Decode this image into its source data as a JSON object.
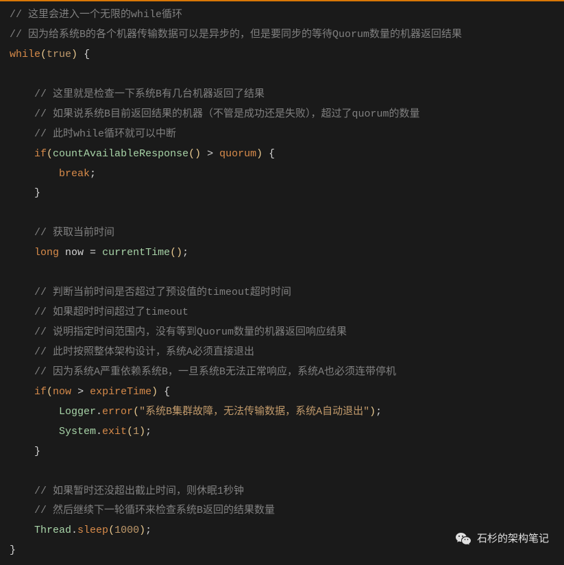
{
  "code": {
    "c1": "// 这里会进入一个无限的while循环",
    "c2": "// 因为给系统B的各个机器传输数据可以是异步的，但是要同步的等待Quorum数量的机器返回结果",
    "kw_while": "while",
    "lp1": "(",
    "true": "true",
    "rp1": ")",
    "lb1": " {",
    "indent1": "    ",
    "indent2": "        ",
    "c3": "// 这里就是检查一下系统B有几台机器返回了结果",
    "c4": "// 如果说系统B目前返回结果的机器（不管是成功还是失败），超过了quorum的数量",
    "c5": "// 此时while循环就可以中断",
    "kw_if1": "if",
    "lp2": "(",
    "fn_count": "countAvailableResponse",
    "lp3": "(",
    "rp3": ")",
    "op_gt1": " > ",
    "var_quorum": "quorum",
    "rp2": ")",
    "lb2": " {",
    "kw_break": "break",
    "semi1": ";",
    "rb1": "}",
    "c6": "// 获取当前时间",
    "kw_long": "long",
    "var_now_decl": " now ",
    "op_eq": "= ",
    "fn_currentTime": "currentTime",
    "lp4": "(",
    "rp4": ")",
    "semi2": ";",
    "c7": "// 判断当前时间是否超过了预设值的timeout超时时间",
    "c8": "// 如果超时时间超过了timeout",
    "c9": "// 说明指定时间范围内，没有等到Quorum数量的机器返回响应结果",
    "c10": "// 此时按照整体架构设计，系统A必须直接退出",
    "c11": "// 因为系统A严重依赖系统B，一旦系统B无法正常响应，系统A也必须连带停机",
    "kw_if2": "if",
    "lp5": "(",
    "var_now": "now",
    "op_gt2": " > ",
    "var_expire": "expireTime",
    "rp5": ")",
    "lb3": " {",
    "cls_logger": "Logger",
    "dot1": ".",
    "m_error": "error",
    "lp6": "(",
    "str_err": "\"系统B集群故障，无法传输数据，系统A自动退出\"",
    "rp6": ")",
    "semi3": ";",
    "cls_system": "System",
    "dot2": ".",
    "m_exit": "exit",
    "lp7": "(",
    "num_1": "1",
    "rp7": ")",
    "semi4": ";",
    "rb2": "}",
    "c12": "// 如果暂时还没超出截止时间，则休眠1秒钟",
    "c13": "// 然后继续下一轮循环来检查系统B返回的结果数量",
    "cls_thread": "Thread",
    "dot3": ".",
    "m_sleep": "sleep",
    "lp8": "(",
    "num_1000": "1000",
    "rp8": ")",
    "semi5": ";",
    "rb3": "}"
  },
  "attribution": {
    "text": "石杉的架构笔记"
  }
}
